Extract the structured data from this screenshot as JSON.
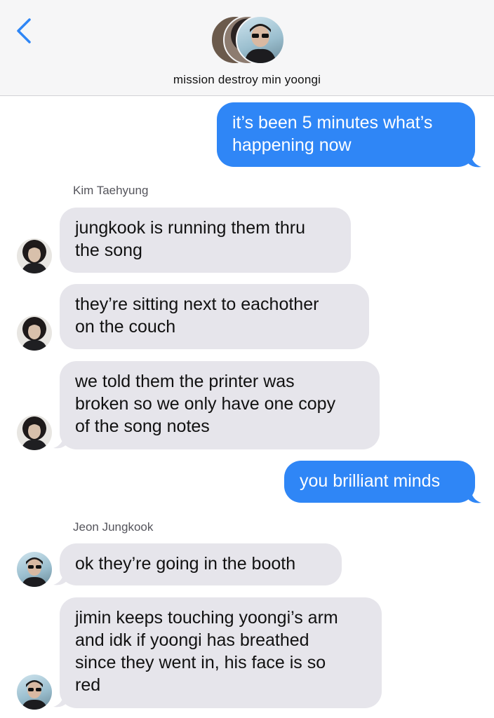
{
  "colors": {
    "outgoing_bubble": "#2f86f6",
    "incoming_bubble": "#e6e5eb",
    "header_background": "#f6f6f7",
    "back_chevron": "#2f86f6"
  },
  "header": {
    "back_icon": "chevron-left-icon",
    "title": "mission destroy min yoongi"
  },
  "messages": {
    "m1": {
      "text": "it’s been 5 minutes what’s\nhappening now"
    },
    "sender1": "Kim Taehyung",
    "m2": {
      "text": "jungkook is running them thru\nthe song"
    },
    "m3": {
      "text": "they’re sitting next to eachother\non the couch"
    },
    "m4": {
      "text": "we told them the printer was\nbroken so we only have one copy\nof the song notes"
    },
    "m5": {
      "text": "you brilliant minds"
    },
    "sender2": "Jeon Jungkook",
    "m6": {
      "text": "ok they’re going in the booth"
    },
    "m7": {
      "text": "jimin keeps touching yoongi’s arm\nand idk if yoongi has breathed\nsince they went in, his face is so\nred"
    }
  }
}
